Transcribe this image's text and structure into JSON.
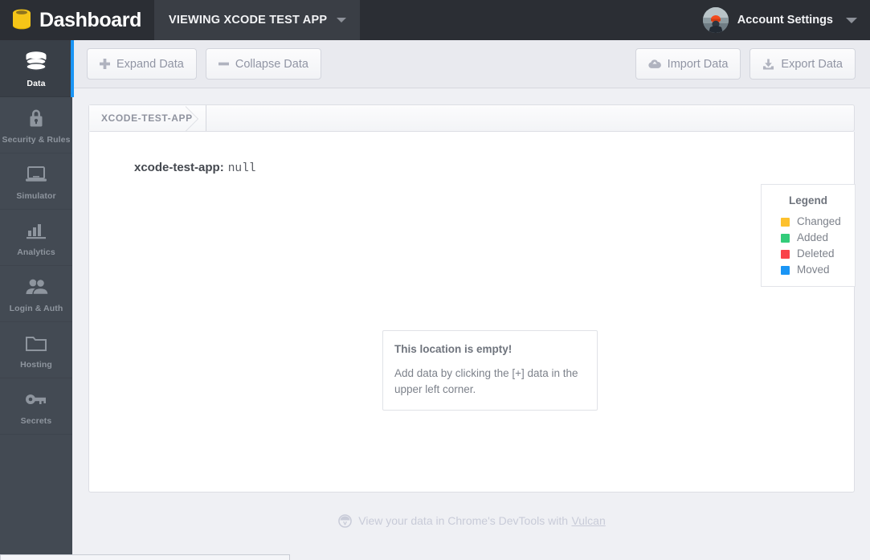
{
  "header": {
    "brand_title": "Dashboard",
    "brand_logo_icon": "database-logo-icon",
    "viewing_app_label": "VIEWING XCODE TEST APP",
    "viewing_chevron_icon": "chevron-down-icon",
    "account_label": "Account Settings",
    "account_avatar_icon": "user-avatar-photo",
    "account_chevron_icon": "chevron-down-icon"
  },
  "sidebar": {
    "items": [
      {
        "label": "Data",
        "icon": "database-icon",
        "active": true
      },
      {
        "label": "Security & Rules",
        "icon": "lock-icon",
        "active": false
      },
      {
        "label": "Simulator",
        "icon": "laptop-icon",
        "active": false
      },
      {
        "label": "Analytics",
        "icon": "bar-chart-icon",
        "active": false
      },
      {
        "label": "Login & Auth",
        "icon": "users-icon",
        "active": false
      },
      {
        "label": "Hosting",
        "icon": "folder-icon",
        "active": false
      },
      {
        "label": "Secrets",
        "icon": "key-icon",
        "active": false
      }
    ],
    "active_accent_color": "#1a95f5"
  },
  "toolbar": {
    "expand_label": "Expand Data",
    "expand_icon": "plus-icon",
    "collapse_label": "Collapse Data",
    "collapse_icon": "minus-icon",
    "import_label": "Import Data",
    "import_icon": "cloud-upload-icon",
    "export_label": "Export Data",
    "export_icon": "download-tray-icon"
  },
  "breadcrumb": {
    "items": [
      "XCODE-TEST-APP"
    ]
  },
  "data_view": {
    "key": "xcode-test-app",
    "separator": ":",
    "value": "null"
  },
  "legend": {
    "title": "Legend",
    "entries": [
      {
        "label": "Changed",
        "color": "#fdc12d"
      },
      {
        "label": "Added",
        "color": "#33cc7a"
      },
      {
        "label": "Deleted",
        "color": "#f9424a"
      },
      {
        "label": "Moved",
        "color": "#1a95f5"
      }
    ]
  },
  "empty_state": {
    "title": "This location is empty!",
    "body": "Add data by clicking the [+] data in the upper left corner."
  },
  "footer": {
    "icon": "vulcan-logo-icon",
    "text": "View your data in Chrome's DevTools with",
    "link_label": "Vulcan"
  }
}
